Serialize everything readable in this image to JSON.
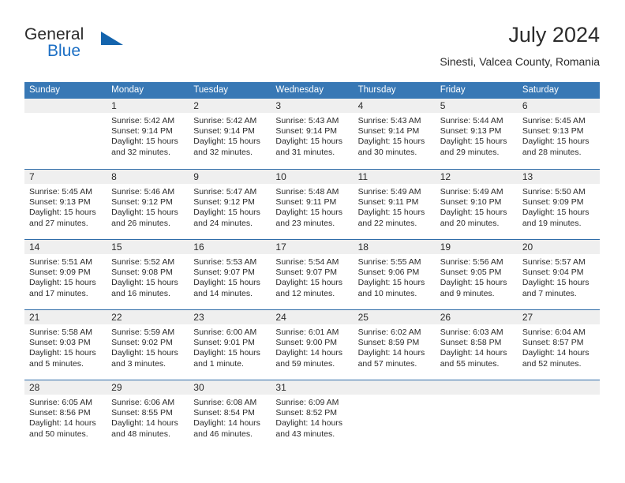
{
  "brand": {
    "name_part1": "General",
    "name_part2": "Blue",
    "triangle_color": "#1464ad",
    "blue_text_color": "#1c6fc4"
  },
  "header": {
    "title": "July 2024",
    "subtitle": "Sinesti, Valcea County, Romania"
  },
  "colors": {
    "header_row_bg": "#3878b5",
    "header_row_text": "#ffffff",
    "week_separator": "#2f6ca8",
    "day_band_bg": "#efefef",
    "cell_bg": "#ffffff",
    "body_text": "#2b2b2b"
  },
  "weekdays": [
    "Sunday",
    "Monday",
    "Tuesday",
    "Wednesday",
    "Thursday",
    "Friday",
    "Saturday"
  ],
  "weeks": [
    [
      {
        "day": "",
        "lines": []
      },
      {
        "day": "1",
        "lines": [
          "Sunrise: 5:42 AM",
          "Sunset: 9:14 PM",
          "Daylight: 15 hours",
          "and 32 minutes."
        ]
      },
      {
        "day": "2",
        "lines": [
          "Sunrise: 5:42 AM",
          "Sunset: 9:14 PM",
          "Daylight: 15 hours",
          "and 32 minutes."
        ]
      },
      {
        "day": "3",
        "lines": [
          "Sunrise: 5:43 AM",
          "Sunset: 9:14 PM",
          "Daylight: 15 hours",
          "and 31 minutes."
        ]
      },
      {
        "day": "4",
        "lines": [
          "Sunrise: 5:43 AM",
          "Sunset: 9:14 PM",
          "Daylight: 15 hours",
          "and 30 minutes."
        ]
      },
      {
        "day": "5",
        "lines": [
          "Sunrise: 5:44 AM",
          "Sunset: 9:13 PM",
          "Daylight: 15 hours",
          "and 29 minutes."
        ]
      },
      {
        "day": "6",
        "lines": [
          "Sunrise: 5:45 AM",
          "Sunset: 9:13 PM",
          "Daylight: 15 hours",
          "and 28 minutes."
        ]
      }
    ],
    [
      {
        "day": "7",
        "lines": [
          "Sunrise: 5:45 AM",
          "Sunset: 9:13 PM",
          "Daylight: 15 hours",
          "and 27 minutes."
        ]
      },
      {
        "day": "8",
        "lines": [
          "Sunrise: 5:46 AM",
          "Sunset: 9:12 PM",
          "Daylight: 15 hours",
          "and 26 minutes."
        ]
      },
      {
        "day": "9",
        "lines": [
          "Sunrise: 5:47 AM",
          "Sunset: 9:12 PM",
          "Daylight: 15 hours",
          "and 24 minutes."
        ]
      },
      {
        "day": "10",
        "lines": [
          "Sunrise: 5:48 AM",
          "Sunset: 9:11 PM",
          "Daylight: 15 hours",
          "and 23 minutes."
        ]
      },
      {
        "day": "11",
        "lines": [
          "Sunrise: 5:49 AM",
          "Sunset: 9:11 PM",
          "Daylight: 15 hours",
          "and 22 minutes."
        ]
      },
      {
        "day": "12",
        "lines": [
          "Sunrise: 5:49 AM",
          "Sunset: 9:10 PM",
          "Daylight: 15 hours",
          "and 20 minutes."
        ]
      },
      {
        "day": "13",
        "lines": [
          "Sunrise: 5:50 AM",
          "Sunset: 9:09 PM",
          "Daylight: 15 hours",
          "and 19 minutes."
        ]
      }
    ],
    [
      {
        "day": "14",
        "lines": [
          "Sunrise: 5:51 AM",
          "Sunset: 9:09 PM",
          "Daylight: 15 hours",
          "and 17 minutes."
        ]
      },
      {
        "day": "15",
        "lines": [
          "Sunrise: 5:52 AM",
          "Sunset: 9:08 PM",
          "Daylight: 15 hours",
          "and 16 minutes."
        ]
      },
      {
        "day": "16",
        "lines": [
          "Sunrise: 5:53 AM",
          "Sunset: 9:07 PM",
          "Daylight: 15 hours",
          "and 14 minutes."
        ]
      },
      {
        "day": "17",
        "lines": [
          "Sunrise: 5:54 AM",
          "Sunset: 9:07 PM",
          "Daylight: 15 hours",
          "and 12 minutes."
        ]
      },
      {
        "day": "18",
        "lines": [
          "Sunrise: 5:55 AM",
          "Sunset: 9:06 PM",
          "Daylight: 15 hours",
          "and 10 minutes."
        ]
      },
      {
        "day": "19",
        "lines": [
          "Sunrise: 5:56 AM",
          "Sunset: 9:05 PM",
          "Daylight: 15 hours",
          "and 9 minutes."
        ]
      },
      {
        "day": "20",
        "lines": [
          "Sunrise: 5:57 AM",
          "Sunset: 9:04 PM",
          "Daylight: 15 hours",
          "and 7 minutes."
        ]
      }
    ],
    [
      {
        "day": "21",
        "lines": [
          "Sunrise: 5:58 AM",
          "Sunset: 9:03 PM",
          "Daylight: 15 hours",
          "and 5 minutes."
        ]
      },
      {
        "day": "22",
        "lines": [
          "Sunrise: 5:59 AM",
          "Sunset: 9:02 PM",
          "Daylight: 15 hours",
          "and 3 minutes."
        ]
      },
      {
        "day": "23",
        "lines": [
          "Sunrise: 6:00 AM",
          "Sunset: 9:01 PM",
          "Daylight: 15 hours",
          "and 1 minute."
        ]
      },
      {
        "day": "24",
        "lines": [
          "Sunrise: 6:01 AM",
          "Sunset: 9:00 PM",
          "Daylight: 14 hours",
          "and 59 minutes."
        ]
      },
      {
        "day": "25",
        "lines": [
          "Sunrise: 6:02 AM",
          "Sunset: 8:59 PM",
          "Daylight: 14 hours",
          "and 57 minutes."
        ]
      },
      {
        "day": "26",
        "lines": [
          "Sunrise: 6:03 AM",
          "Sunset: 8:58 PM",
          "Daylight: 14 hours",
          "and 55 minutes."
        ]
      },
      {
        "day": "27",
        "lines": [
          "Sunrise: 6:04 AM",
          "Sunset: 8:57 PM",
          "Daylight: 14 hours",
          "and 52 minutes."
        ]
      }
    ],
    [
      {
        "day": "28",
        "lines": [
          "Sunrise: 6:05 AM",
          "Sunset: 8:56 PM",
          "Daylight: 14 hours",
          "and 50 minutes."
        ]
      },
      {
        "day": "29",
        "lines": [
          "Sunrise: 6:06 AM",
          "Sunset: 8:55 PM",
          "Daylight: 14 hours",
          "and 48 minutes."
        ]
      },
      {
        "day": "30",
        "lines": [
          "Sunrise: 6:08 AM",
          "Sunset: 8:54 PM",
          "Daylight: 14 hours",
          "and 46 minutes."
        ]
      },
      {
        "day": "31",
        "lines": [
          "Sunrise: 6:09 AM",
          "Sunset: 8:52 PM",
          "Daylight: 14 hours",
          "and 43 minutes."
        ]
      },
      {
        "day": "",
        "lines": []
      },
      {
        "day": "",
        "lines": []
      },
      {
        "day": "",
        "lines": []
      }
    ]
  ]
}
